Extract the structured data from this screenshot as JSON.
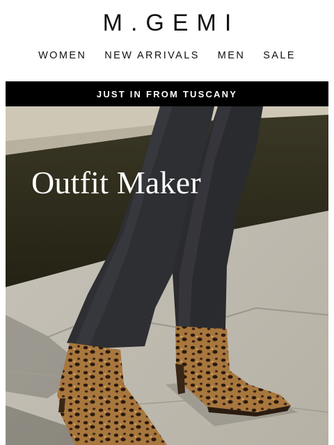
{
  "brand": {
    "logo_text": "M.GEMI"
  },
  "nav": {
    "items": [
      "WOMEN",
      "NEW ARRIVALS",
      "MEN",
      "SALE"
    ]
  },
  "banner": {
    "text": "JUST IN FROM TUSCANY"
  },
  "hero": {
    "title": "Outfit Maker"
  },
  "colors": {
    "banner_bg": "#000000",
    "banner_text": "#ffffff",
    "hero_title": "#ffffff",
    "denim": "#2e2f33"
  }
}
